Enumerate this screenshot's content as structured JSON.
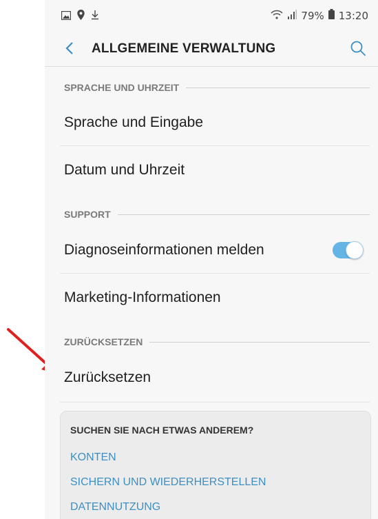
{
  "statusbar": {
    "icons_left": [
      "image-icon",
      "location-pin-icon",
      "download-icon"
    ],
    "battery": "79%",
    "time": "13:20"
  },
  "appbar": {
    "title": "ALLGEMEINE VERWALTUNG"
  },
  "sections": [
    {
      "header": "SPRACHE UND UHRZEIT",
      "items": [
        "Sprache und Eingabe",
        "Datum und Uhrzeit"
      ]
    },
    {
      "header": "SUPPORT",
      "items": [
        "Diagnoseinformationen melden",
        "Marketing-Informationen"
      ]
    },
    {
      "header": "ZURÜCKSETZEN",
      "items": [
        "Zurücksetzen"
      ]
    }
  ],
  "toggle": {
    "diagnose_on": true,
    "color": "#64b5e6"
  },
  "card": {
    "title": "SUCHEN SIE NACH ETWAS ANDEREM?",
    "links": [
      "KONTEN",
      "SICHERN UND WIEDERHERSTELLEN",
      "DATENNUTZUNG"
    ]
  },
  "colors": {
    "accent": "#3d8fc2",
    "annotation_arrow": "#e02020"
  }
}
